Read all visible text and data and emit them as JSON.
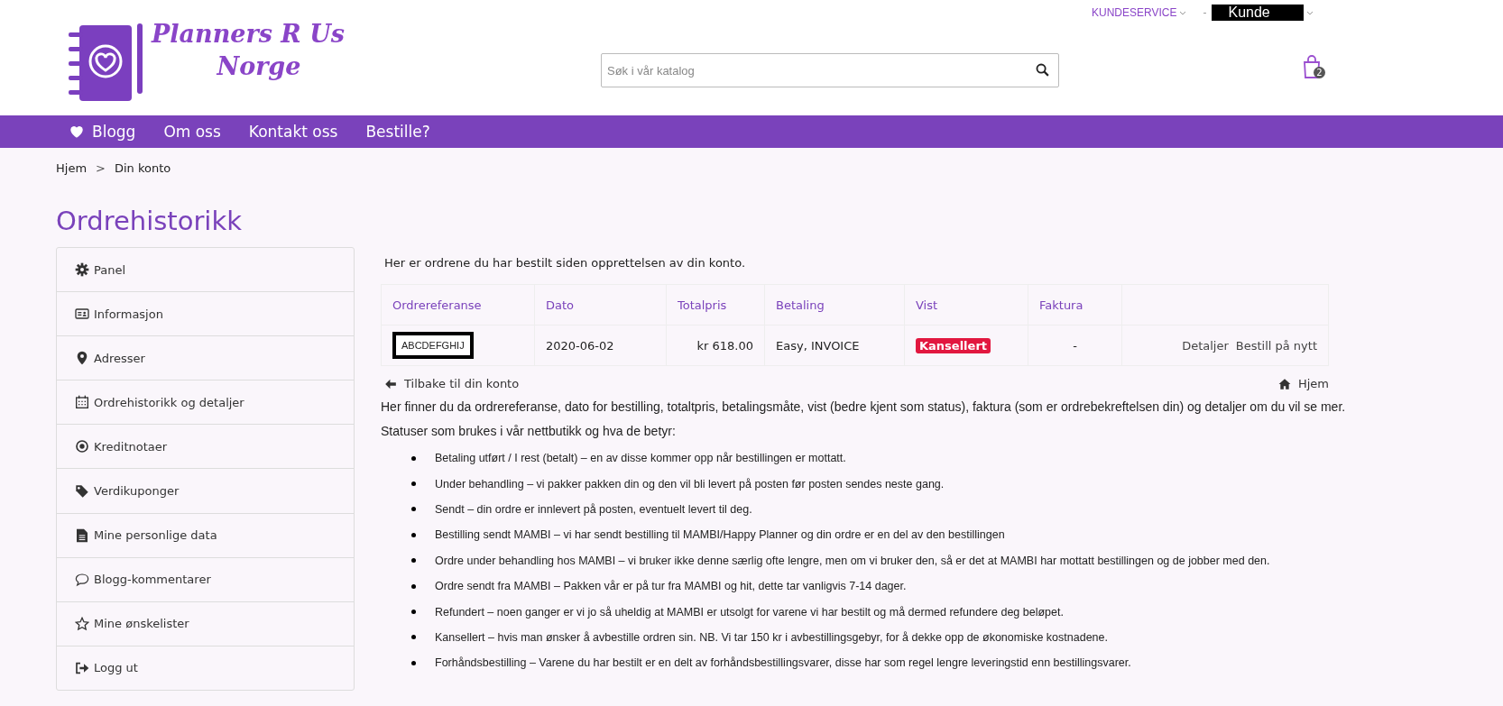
{
  "header": {
    "logo": {
      "line1": "Planners R Us",
      "line2": "Norge"
    },
    "top_links": [
      {
        "label": "KUNDESERVICE",
        "kind": "plain"
      },
      {
        "label": "Kunde",
        "kind": "account",
        "prefix": "-"
      }
    ],
    "search": {
      "placeholder": "Søk i vår katalog"
    },
    "cart": {
      "count": "2"
    }
  },
  "nav": [
    {
      "label": "Blogg",
      "kind": "heart"
    },
    {
      "label": "Om oss"
    },
    {
      "label": "Kontakt oss"
    },
    {
      "label": "Bestille?"
    }
  ],
  "breadcrumb": {
    "separator": ">",
    "items": [
      "Hjem",
      "Din konto"
    ]
  },
  "page_title": "Ordrehistorikk",
  "sidebar": {
    "items": [
      {
        "label": "Panel",
        "kind": "gear"
      },
      {
        "label": "Informasjon",
        "kind": "card"
      },
      {
        "label": "Adresser",
        "kind": "pin"
      },
      {
        "label": "Ordrehistorikk og detaljer",
        "kind": "calendar"
      },
      {
        "label": "Kreditnotaer",
        "kind": "circle"
      },
      {
        "label": "Verdikuponger",
        "kind": "tag"
      },
      {
        "label": "Mine personlige data",
        "kind": "document"
      },
      {
        "label": "Blogg-kommentarer",
        "kind": "comment"
      },
      {
        "label": "Mine ønskelister",
        "kind": "star"
      },
      {
        "label": "Logg ut",
        "kind": "logout"
      }
    ]
  },
  "intro": "Her er ordrene du har bestilt siden opprettelsen av din konto.",
  "table": {
    "columns": [
      "Ordrereferanse",
      "Dato",
      "Totalpris",
      "Betaling",
      "Vist",
      "Faktura"
    ],
    "rows": [
      {
        "reference": "ABCDEFGHIJ",
        "date": "2020-06-02",
        "total": "kr 618.00",
        "payment": "Easy, INVOICE",
        "status": {
          "label": "Kansellert",
          "color": "#e2173f"
        },
        "invoice": "-",
        "actions": [
          "Detaljer",
          "Bestill på nytt"
        ]
      }
    ]
  },
  "links": [
    {
      "label": "Tilbake til din konto",
      "kind": "back"
    },
    {
      "label": "Hjem",
      "kind": "home"
    }
  ],
  "info": {
    "paragraphs": [
      "Her finner du da ordrereferanse, dato for bestilling, totaltpris, betalingsmåte, vist (bedre kjent som status), faktura (som er ordrebekreftelsen din) og detaljer om du vil se mer.",
      "Statuser som brukes i vår nettbutikk og hva de betyr:"
    ],
    "statuses": [
      "Betaling utført / I rest (betalt) – en av disse kommer opp når bestillingen er mottatt.",
      "Under behandling – vi pakker pakken din og den vil bli levert på posten før posten sendes neste gang.",
      "Sendt – din ordre er innlevert på posten, eventuelt levert til deg.",
      "Bestilling sendt MAMBI – vi har sendt bestilling til MAMBI/Happy Planner og din ordre er en del av den bestillingen",
      "Ordre under behandling hos MAMBI – vi bruker ikke denne særlig ofte lengre, men om vi bruker den, så er det at MAMBI har mottatt bestillingen og de jobber med den.",
      "Ordre sendt fra MAMBI – Pakken vår er på tur fra MAMBI og hit, dette tar vanligvis 7-14 dager.",
      "Refundert – noen ganger er vi jo så uheldig at MAMBI er utsolgt for varene vi har bestilt og må dermed refundere deg beløpet.",
      "Kansellert – hvis man ønsker å avbestille ordren sin. NB. Vi tar 150 kr i avbestillingsgebyr, for å dekke opp de økonomiske kostnadene.",
      "Forhåndsbestilling – Varene du har bestilt er en delt av forhåndsbestillingsvarer, disse har som regel lengre leveringstid enn bestillingsvarer."
    ]
  }
}
